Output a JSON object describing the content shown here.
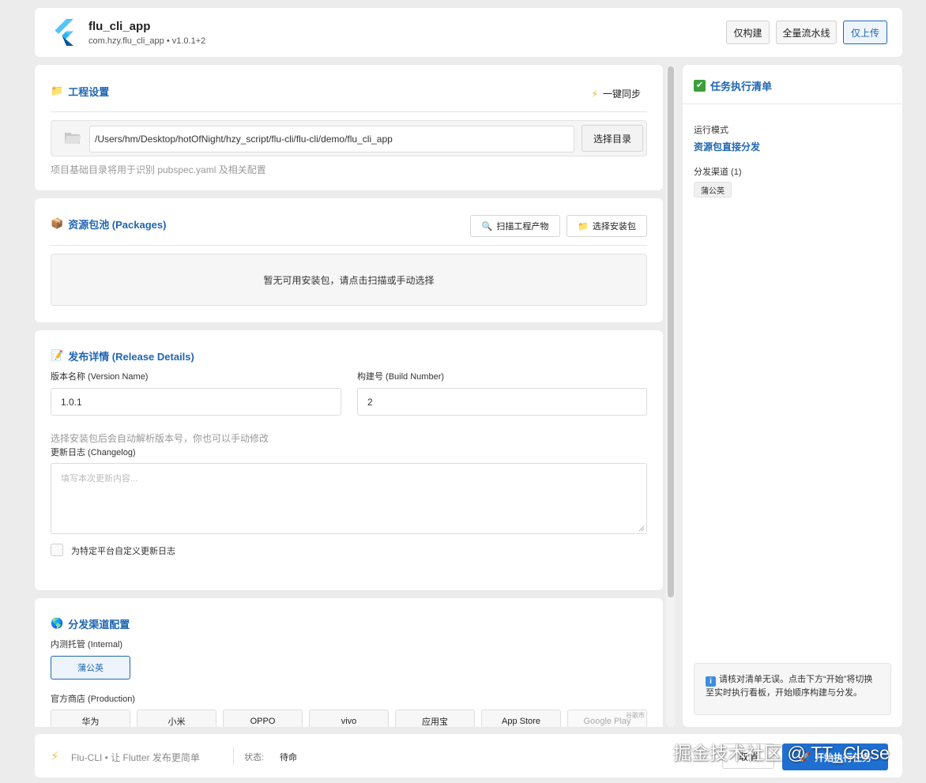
{
  "header": {
    "app_name": "flu_cli_app",
    "app_subtitle": "com.hzy.flu_cli_app • v1.0.1+2",
    "buttons": {
      "build_only": "仅构建",
      "full_pipeline": "全量流水线",
      "upload_only": "仅上传"
    }
  },
  "project": {
    "title": "工程设置",
    "sync_label": "一键同步",
    "path_value": "/Users/hm/Desktop/hotOfNight/hzy_script/flu-cli/flu-cli/demo/flu_cli_app",
    "choose_dir": "选择目录",
    "hint": "项目基础目录将用于识别 pubspec.yaml 及相关配置"
  },
  "packages": {
    "title": "资源包池 (Packages)",
    "scan_button": "扫描工程产物",
    "select_button": "选择安装包",
    "empty_text": "暂无可用安装包，请点击扫描或手动选择"
  },
  "release": {
    "title": "发布详情 (Release Details)",
    "version_label": "版本名称 (Version Name)",
    "version_value": "1.0.1",
    "build_label": "构建号 (Build Number)",
    "build_value": "2",
    "version_hint": "选择安装包后会自动解析版本号，你也可以手动修改",
    "changelog_label": "更新日志 (Changelog)",
    "changelog_placeholder": "填写本次更新内容...",
    "custom_changelog_label": "为特定平台自定义更新日志"
  },
  "channels": {
    "title": "分发渠道配置",
    "internal_label": "内测托管 (Internal)",
    "internal_selected": "蒲公英",
    "production_label": "官方商店 (Production)",
    "stores": [
      "华为",
      "小米",
      "OPPO",
      "vivo",
      "应用宝",
      "App Store",
      "Google Play"
    ],
    "google_tag": "谷歌市"
  },
  "side": {
    "title": "任务执行清单",
    "mode_label": "运行模式",
    "mode_value": "资源包直接分发",
    "channels_label": "分发渠道 (1)",
    "channel_chip": "蒲公英",
    "notice": "请核对清单无误。点击下方“开始”将切换至实时执行看板，开始顺序构建与分发。"
  },
  "footer": {
    "brand": "Flu-CLI • 让 Flutter 发布更简单",
    "status_label": "状态:",
    "status_value": "待命",
    "cancel": "取消",
    "start": "开始执行任务"
  },
  "watermark": "掘金技术社区 @ TT_Close",
  "colors": {
    "accent": "#1f66b3",
    "primary_button": "#1f6fd0",
    "bolt": "#f0b400"
  }
}
